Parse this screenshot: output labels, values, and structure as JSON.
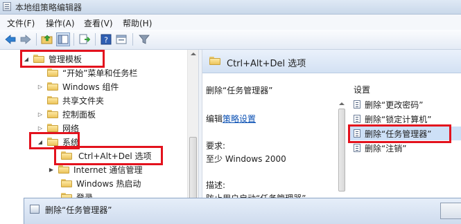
{
  "window": {
    "title": "本地组策略编辑器"
  },
  "menubar": {
    "items": [
      {
        "label": "文件(F)"
      },
      {
        "label": "操作(A)"
      },
      {
        "label": "查看(V)"
      },
      {
        "label": "帮助(H)"
      }
    ]
  },
  "toolbar": {
    "icons": [
      "back-arrow-icon",
      "forward-arrow-icon",
      "up-folder-icon",
      "show-hide-tree-icon",
      "export-list-icon",
      "help-icon",
      "properties-icon",
      "filter-icon"
    ]
  },
  "tree": {
    "items": [
      {
        "label": "管理模板",
        "expanded": true
      },
      {
        "label": "“开始”菜单和任务栏"
      },
      {
        "label": "Windows 组件"
      },
      {
        "label": "共享文件夹"
      },
      {
        "label": "控制面板"
      },
      {
        "label": "网络"
      },
      {
        "label": "系统",
        "expanded": true
      },
      {
        "label": "Ctrl+Alt+Del 选项",
        "selected": true
      },
      {
        "label": "Internet 通信管理"
      },
      {
        "label": "Windows 热启动"
      },
      {
        "label": "登录"
      }
    ]
  },
  "details": {
    "header": "Ctrl+Alt+Del 选项",
    "policy_title": "删除“任务管理器”",
    "edit_prefix": "编辑",
    "edit_link": "策略设置",
    "requirement_label": "要求:",
    "requirement_value": "至少 Windows 2000",
    "description_label": "描述:",
    "description_value": "防止用户启动“任务管理器”"
  },
  "settings": {
    "column_header": "设置",
    "items": [
      {
        "label": "删除“更改密码”"
      },
      {
        "label": "删除“锁定计算机”"
      },
      {
        "label": "删除“任务管理器”",
        "selected": true
      },
      {
        "label": "删除“注销”"
      }
    ]
  },
  "dialog": {
    "title": "删除“任务管理器”"
  },
  "colors": {
    "highlight": "#e3121d",
    "link": "#0a50b4",
    "selection": "#cde0f7"
  }
}
